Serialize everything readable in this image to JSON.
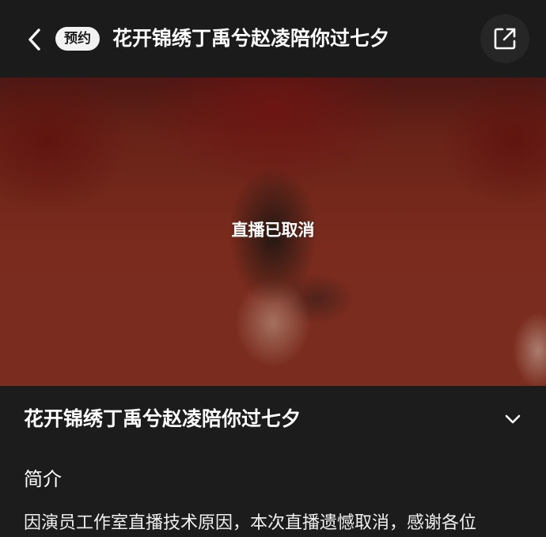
{
  "header": {
    "badge": "预约",
    "title": "花开锦绣丁禹兮赵凌陪你过七夕"
  },
  "video": {
    "status": "直播已取消"
  },
  "info": {
    "title": "花开锦绣丁禹兮赵凌陪你过七夕",
    "intro_heading": "简介",
    "intro_text": "因演员工作室直播技术原因，本次直播遗憾取消，感谢各位"
  },
  "icons": {
    "back": "chevron-left-icon",
    "share": "share-external-icon",
    "expand": "chevron-down-icon"
  }
}
